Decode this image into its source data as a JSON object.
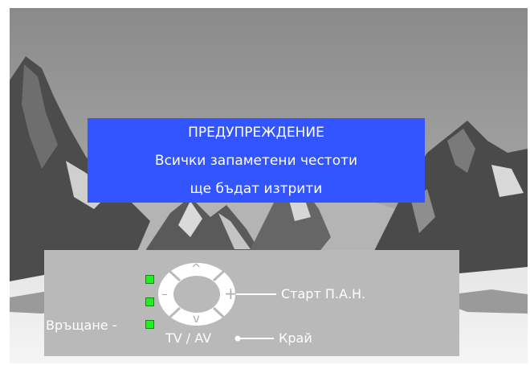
{
  "colors": {
    "warning_bg": "#3355ff",
    "panel_bg": "#b9b9b9",
    "indicator": "#22ee22",
    "text": "#ffffff"
  },
  "background": {
    "icon": "mountain-landscape"
  },
  "warning": {
    "title": "ПРЕДУПРЕЖДЕНИЕ",
    "line1": "Всички запаметени честоти",
    "line2": "ще бъдат изтрити"
  },
  "panel": {
    "back_label": "Връщане",
    "source_label": "TV / AV",
    "start_label": "Старт П.А.Н.",
    "exit_label": "Край",
    "remote": {
      "up": "^",
      "down": "v",
      "left": "–",
      "right": "+"
    },
    "indicators": 3
  }
}
